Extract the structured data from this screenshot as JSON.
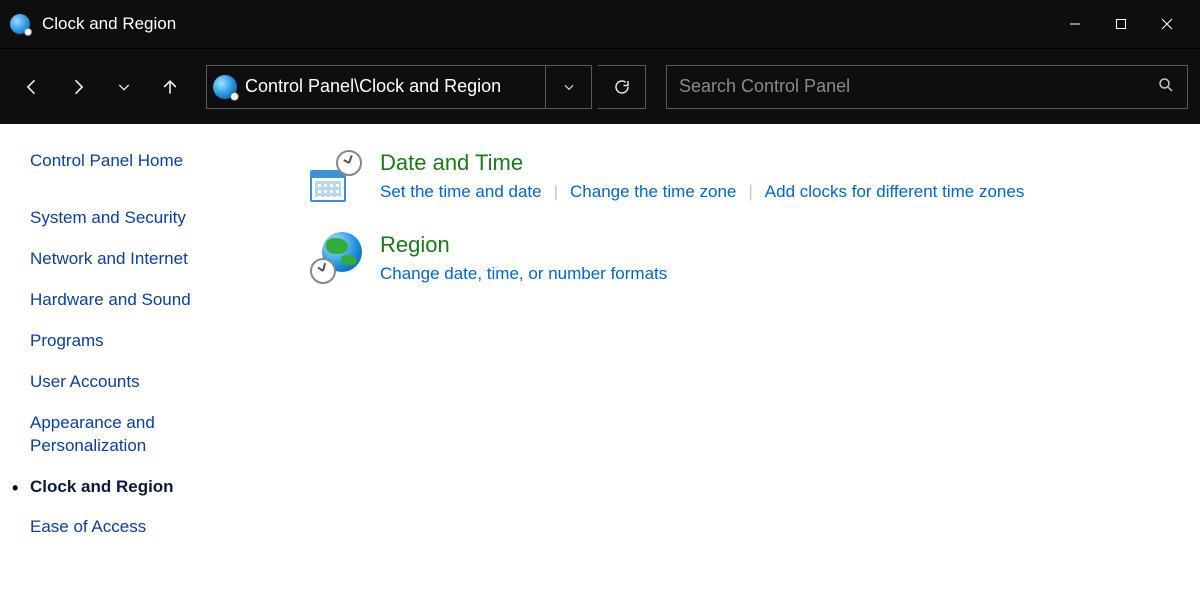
{
  "window": {
    "title": "Clock and Region"
  },
  "toolbar": {
    "address": "Control Panel\\Clock and Region",
    "search_placeholder": "Search Control Panel"
  },
  "sidebar": {
    "home": "Control Panel Home",
    "items": [
      "System and Security",
      "Network and Internet",
      "Hardware and Sound",
      "Programs",
      "User Accounts",
      "Appearance and Personalization",
      "Clock and Region",
      "Ease of Access"
    ],
    "current_index": 6
  },
  "main": {
    "categories": [
      {
        "title": "Date and Time",
        "tasks": [
          "Set the time and date",
          "Change the time zone",
          "Add clocks for different time zones"
        ]
      },
      {
        "title": "Region",
        "tasks": [
          "Change date, time, or number formats"
        ]
      }
    ]
  }
}
